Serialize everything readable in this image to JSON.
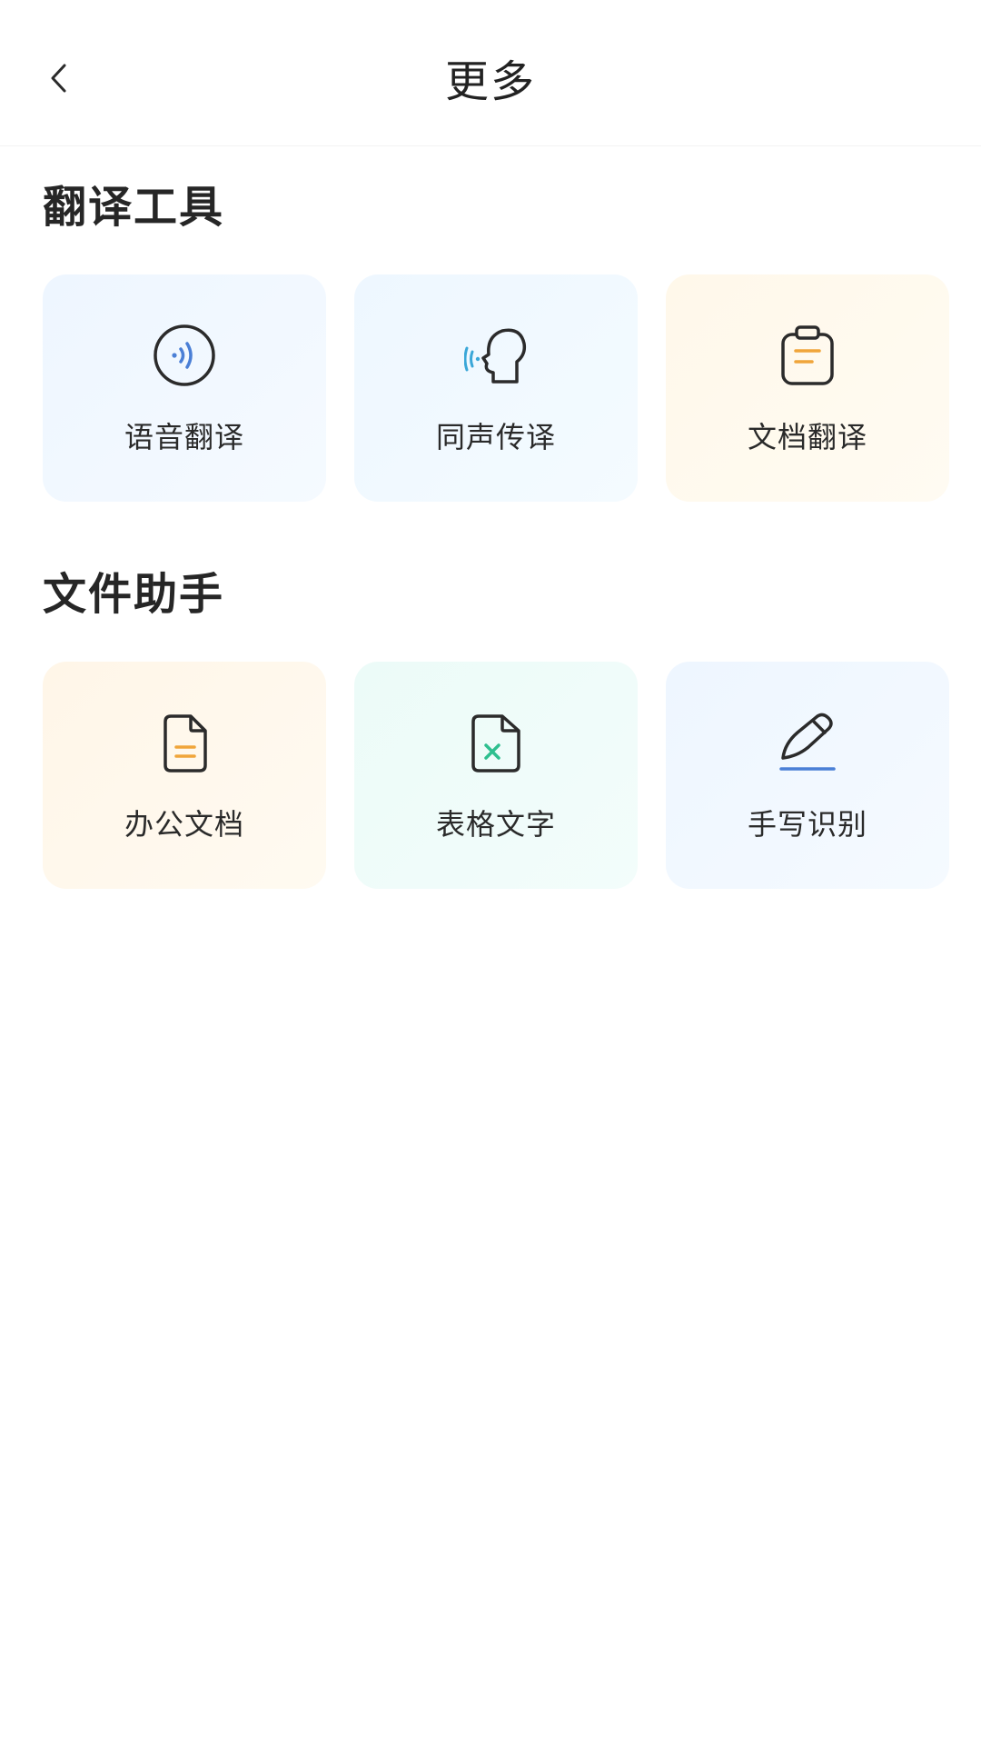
{
  "header": {
    "title": "更多",
    "back_icon": "chevron-left-icon"
  },
  "sections": [
    {
      "title": "翻译工具",
      "items": [
        {
          "label": "语音翻译",
          "icon": "voice-wave-icon",
          "accent": "#4a7fd6"
        },
        {
          "label": "同声传译",
          "icon": "speaking-head-icon",
          "accent": "#3aa7d8"
        },
        {
          "label": "文档翻译",
          "icon": "clipboard-icon",
          "accent": "#f0a53a"
        }
      ]
    },
    {
      "title": "文件助手",
      "items": [
        {
          "label": "办公文档",
          "icon": "document-icon",
          "accent": "#f0a53a"
        },
        {
          "label": "表格文字",
          "icon": "spreadsheet-x-icon",
          "accent": "#2fbf8f"
        },
        {
          "label": "手写识别",
          "icon": "pen-icon",
          "accent": "#4a7fd6"
        }
      ]
    }
  ],
  "colors": {
    "text_primary": "#222222",
    "icon_stroke": "#2b2b2b"
  }
}
